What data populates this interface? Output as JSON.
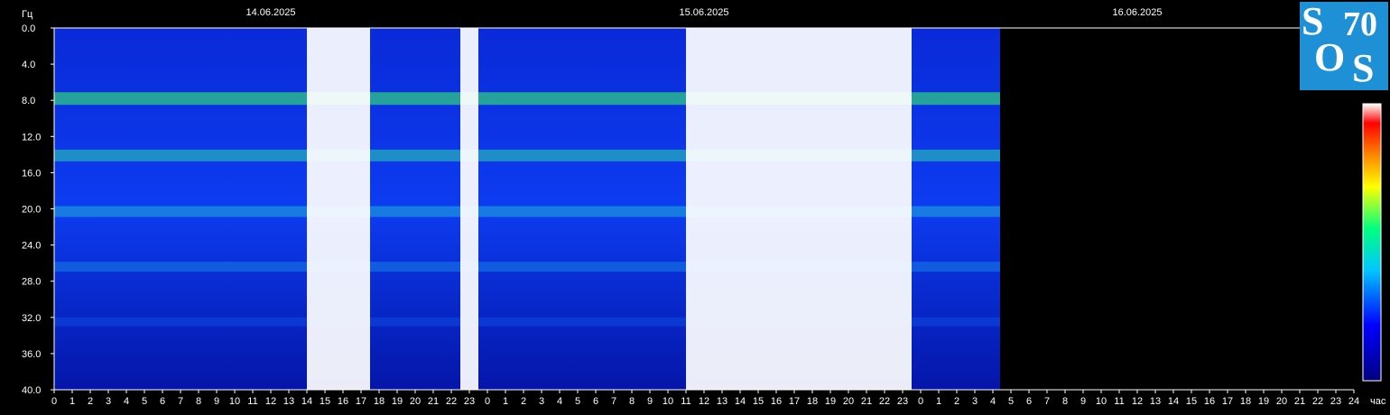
{
  "chart_data": {
    "type": "heatmap",
    "ylabel": "Гц",
    "xlabel": "час",
    "dates": [
      "14.06.2025",
      "15.06.2025",
      "16.06.2025"
    ],
    "y_ticks": [
      "0.0",
      "4.0",
      "8.0",
      "12.0",
      "16.0",
      "20.0",
      "24.0",
      "28.0",
      "32.0",
      "36.0",
      "40.0"
    ],
    "ylim": [
      0,
      40
    ],
    "x_ticks": [
      "0",
      "1",
      "2",
      "3",
      "4",
      "5",
      "6",
      "7",
      "8",
      "9",
      "10",
      "11",
      "12",
      "13",
      "14",
      "15",
      "16",
      "17",
      "18",
      "19",
      "20",
      "21",
      "22",
      "23",
      "0",
      "1",
      "2",
      "3",
      "4",
      "5",
      "6",
      "7",
      "8",
      "9",
      "10",
      "11",
      "12",
      "13",
      "14",
      "15",
      "16",
      "17",
      "18",
      "19",
      "20",
      "21",
      "22",
      "23",
      "0",
      "1",
      "2",
      "3",
      "4",
      "5",
      "6",
      "7",
      "8",
      "9",
      "10",
      "11",
      "12",
      "13",
      "14",
      "15",
      "16",
      "17",
      "18",
      "19",
      "20",
      "21",
      "22",
      "23",
      "24"
    ],
    "xlim_hours": [
      0,
      72
    ],
    "data_end_hour": 52.4,
    "resonance_bands_hz": [
      7.8,
      14.1,
      20.3,
      26.4,
      32.5
    ],
    "high_intensity_periods_hours": [
      [
        14,
        17.5
      ],
      [
        22.5,
        23.5
      ],
      [
        35,
        47.5
      ]
    ],
    "colorscale": [
      "#000080",
      "#0000ff",
      "#00c8ff",
      "#00ff80",
      "#ffff00",
      "#ff8000",
      "#ff0000",
      "#ffffff"
    ]
  },
  "logo": {
    "c1": "S",
    "c2": "70",
    "c3": "O",
    "c4": "S"
  }
}
